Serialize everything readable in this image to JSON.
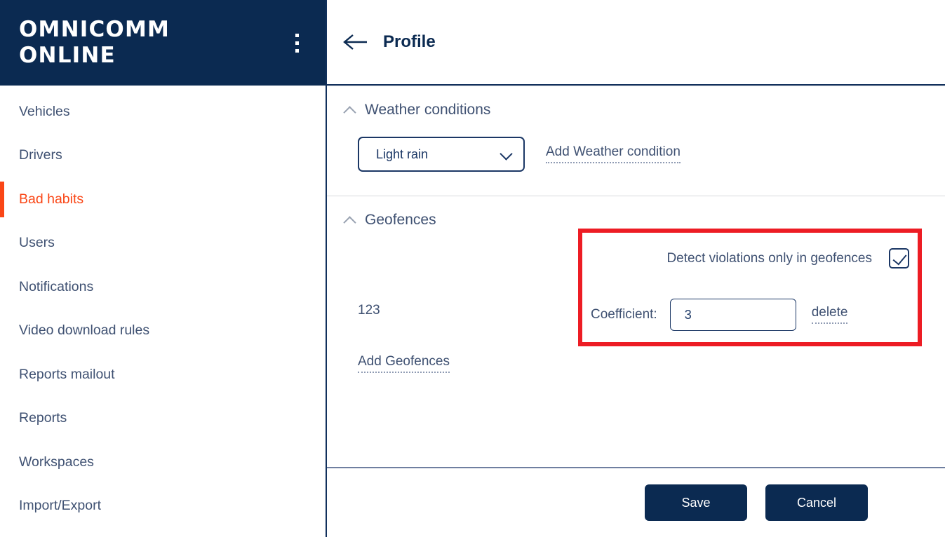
{
  "brand": {
    "logo_text": "OMNICOMM\nONLINE",
    "kebab_icon": "kebab-menu-icon"
  },
  "sidebar": {
    "items": [
      {
        "label": "Vehicles",
        "active": false
      },
      {
        "label": "Drivers",
        "active": false
      },
      {
        "label": "Bad habits",
        "active": true
      },
      {
        "label": "Users",
        "active": false
      },
      {
        "label": "Notifications",
        "active": false
      },
      {
        "label": "Video download rules",
        "active": false
      },
      {
        "label": "Reports mailout",
        "active": false
      },
      {
        "label": "Reports",
        "active": false
      },
      {
        "label": "Workspaces",
        "active": false
      },
      {
        "label": "Import/Export",
        "active": false
      }
    ]
  },
  "header": {
    "back_icon": "arrow-left-icon",
    "title": "Profile"
  },
  "weather_section": {
    "title": "Weather conditions",
    "collapse_icon": "chevron-up-icon",
    "select": {
      "value": "Light rain",
      "chevron_icon": "chevron-down-icon"
    },
    "add_link": "Add Weather condition"
  },
  "geofences_section": {
    "title": "Geofences",
    "collapse_icon": "chevron-up-icon",
    "detect_label": "Detect violations only in geofences",
    "detect_checked": "true",
    "geofence_name": "123",
    "coefficient_label": "Coefficient:",
    "coefficient_value": "3",
    "coefficient_placeholder": "",
    "delete_link": "delete",
    "add_link": "Add Geofences"
  },
  "footer": {
    "save_label": "Save",
    "cancel_label": "Cancel"
  },
  "colors": {
    "brand_navy": "#0b2a51",
    "accent_orange": "#fa4616",
    "highlight_red": "#ed1c24",
    "text_slate": "#3f5172"
  }
}
